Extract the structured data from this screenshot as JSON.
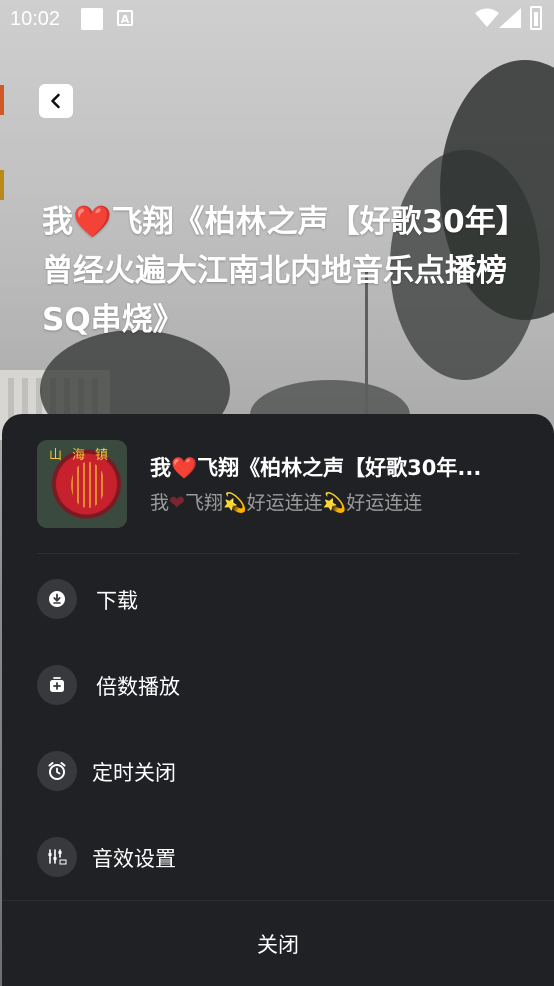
{
  "status_bar": {
    "time": "10:02",
    "icons": [
      "notification-square-icon",
      "a-icon",
      "wifi-icon",
      "signal-icon",
      "battery-icon"
    ],
    "a_glyph": "A"
  },
  "header": {
    "back_icon": "chevron-left-icon",
    "title_before": "我",
    "title_heart": "❤️",
    "title_after": "飞翔《柏林之声【好歌30年】曾经火遍大江南北内地音乐点播榜SQ串烧》"
  },
  "sheet": {
    "cover_text": "山海镇",
    "track_title_before": "我",
    "track_title_heart": "❤️",
    "track_title_after": "飞翔《柏林之声【好歌30年...",
    "track_subtitle_before": "我",
    "track_subtitle_heart": "❤",
    "track_subtitle_after": "飞翔💫好运连连💫好运连连",
    "menu": [
      {
        "label": "下载",
        "icon": "download-icon"
      },
      {
        "label": "倍数播放",
        "icon": "playback-speed-icon"
      },
      {
        "label": "定时关闭",
        "icon": "alarm-clock-icon"
      },
      {
        "label": "音效设置",
        "icon": "sound-effects-icon"
      }
    ],
    "close_label": "关闭"
  },
  "colors": {
    "sheet_bg": "#202124",
    "icon_circle": "#38393c",
    "subtitle_gray": "#9b9b9b",
    "heart_red": "#e0182d"
  }
}
